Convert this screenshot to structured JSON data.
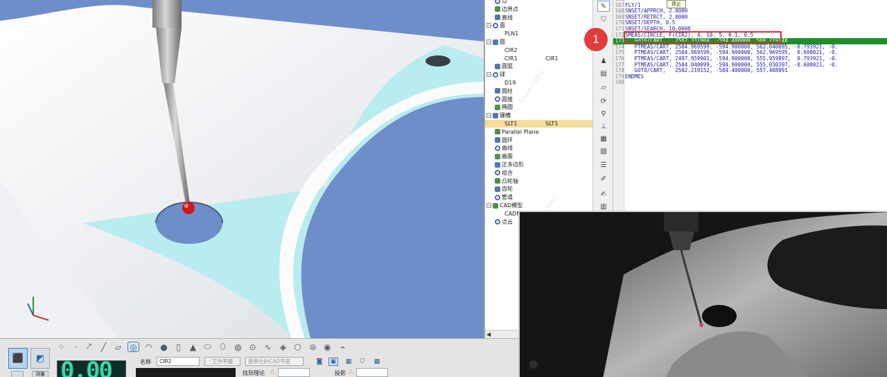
{
  "tree": {
    "items": [
      {
        "label": "点",
        "col2": "",
        "indent": 12,
        "type": "item"
      },
      {
        "label": "边界点",
        "col2": "",
        "indent": 12,
        "type": "item"
      },
      {
        "label": "直线",
        "col2": "",
        "indent": 12,
        "type": "item"
      },
      {
        "label": "面",
        "col2": "",
        "indent": 0,
        "type": "group"
      },
      {
        "label": "PLN1",
        "col2": "",
        "indent": 26,
        "type": "leaf"
      },
      {
        "label": "圆",
        "col2": "",
        "indent": 0,
        "type": "group"
      },
      {
        "label": "CIR2",
        "col2": "",
        "indent": 26,
        "type": "leaf"
      },
      {
        "label": "CIR1",
        "col2": "CIR1",
        "indent": 26,
        "type": "leaf"
      },
      {
        "label": "圆弧",
        "col2": "",
        "indent": 12,
        "type": "item"
      },
      {
        "label": "球",
        "col2": "",
        "indent": 0,
        "type": "group"
      },
      {
        "label": "D19",
        "col2": "",
        "indent": 26,
        "type": "leaf"
      },
      {
        "label": "圆柱",
        "col2": "",
        "indent": 12,
        "type": "item"
      },
      {
        "label": "圆锥",
        "col2": "",
        "indent": 12,
        "type": "item"
      },
      {
        "label": "椭圆",
        "col2": "",
        "indent": 12,
        "type": "item"
      },
      {
        "label": "键槽",
        "col2": "",
        "indent": 0,
        "type": "group"
      },
      {
        "label": "SLT1",
        "col2": "SLT1",
        "indent": 26,
        "type": "leaf",
        "selected": true
      },
      {
        "label": "Parallel Plane",
        "col2": "",
        "indent": 12,
        "type": "item"
      },
      {
        "label": "圆环",
        "col2": "",
        "indent": 12,
        "type": "item"
      },
      {
        "label": "曲线",
        "col2": "",
        "indent": 12,
        "type": "item"
      },
      {
        "label": "曲面",
        "col2": "",
        "indent": 12,
        "type": "item"
      },
      {
        "label": "正多边形",
        "col2": "",
        "indent": 12,
        "type": "item"
      },
      {
        "label": "组合",
        "col2": "",
        "indent": 12,
        "type": "item"
      },
      {
        "label": "凸轮轴",
        "col2": "",
        "indent": 12,
        "type": "item"
      },
      {
        "label": "齿轮",
        "col2": "",
        "indent": 12,
        "type": "item"
      },
      {
        "label": "管道",
        "col2": "",
        "indent": 12,
        "type": "item"
      },
      {
        "label": "CAD模型",
        "col2": "",
        "indent": 0,
        "type": "group"
      },
      {
        "label": "CADM",
        "col2": "",
        "indent": 26,
        "type": "leaf"
      },
      {
        "label": "点云",
        "col2": "",
        "indent": 12,
        "type": "item"
      }
    ],
    "group_prefix_cad": "CAD"
  },
  "editor": {
    "tooltip": "停止",
    "lines": [
      {
        "n": "168",
        "text": ""
      },
      {
        "n": "167",
        "text": "FLY/1"
      },
      {
        "n": "168",
        "text": "SNSET/APPRCH, 2.0000"
      },
      {
        "n": "169",
        "text": "SNSET/RETRCT, 2.0000"
      },
      {
        "n": "170",
        "text": "SNSET/DEPTH, 0.5"
      },
      {
        "n": "171",
        "text": "SNSET/SEARCH, 10.0000"
      },
      {
        "n": "172",
        "text": "SMEAS/CIRCLE, F(CIR2), 4, 10, 5, 0.1, 0.5"
      },
      {
        "n": "173",
        "text": "   GOTO/CART,   2502.331904, -584.400000, 560.219148",
        "highlight": true
      },
      {
        "n": "174",
        "text": "   PTMEAS/CART, 2504.969599, -594.900000, 562.040095, -0.793921, -0."
      },
      {
        "n": "175",
        "text": "   PTMEAS/CART, 2504.969599, -594.900000, 562.969595,  0.608021, -0."
      },
      {
        "n": "176",
        "text": "   PTMEAS/CART, 2497.959901, -594.900000, 555.959897,  0.793921, -0."
      },
      {
        "n": "177",
        "text": "   PTMEAS/CART, 2504.040099, -594.900000, 555.030397, -0.608021, -0."
      },
      {
        "n": "178",
        "text": "   GOTO/CART,   2502.219152, -584.400000, 557.408091"
      },
      {
        "n": "179",
        "text": "ENDMES"
      },
      {
        "n": "180",
        "text": ""
      }
    ]
  },
  "step_marker": "1",
  "bottom": {
    "counter": "0.00",
    "name_label": "名称",
    "name_value": "CIR2",
    "work_plane_btn": "工作平面",
    "cad_plane_select": "最靠近的CAD平面",
    "find_theory_label": "找到理论",
    "projection_label": "投影",
    "measure_btn_label": "测量"
  }
}
